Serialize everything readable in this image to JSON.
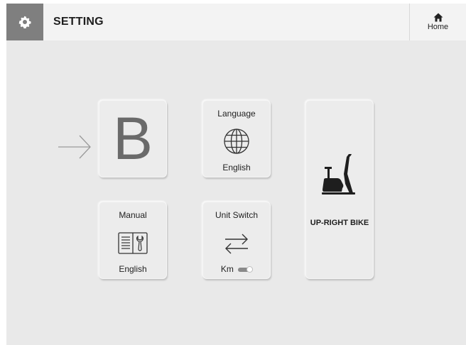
{
  "header": {
    "title": "SETTING",
    "settings_icon": "gear-icon",
    "home_icon": "home-icon",
    "home_label": "Home"
  },
  "main": {
    "brand_card": {
      "letter": "B",
      "indicator_icon": "right-arrow-icon"
    },
    "language_card": {
      "title": "Language",
      "icon": "globe-icon",
      "value": "English"
    },
    "manual_card": {
      "title": "Manual",
      "icon": "manual-book-icon",
      "value": "English"
    },
    "unit_card": {
      "title": "Unit Switch",
      "icon": "swap-arrows-icon",
      "value": "Km",
      "toggle_on": true
    },
    "bike_card": {
      "icon": "upright-bike-icon",
      "label": "UP-RIGHT BIKE"
    }
  },
  "colors": {
    "header_bg": "#f3f3f3",
    "gear_box_bg": "#7f7f7f",
    "main_bg": "#e9e9e9",
    "card_bg": "#ececec"
  }
}
